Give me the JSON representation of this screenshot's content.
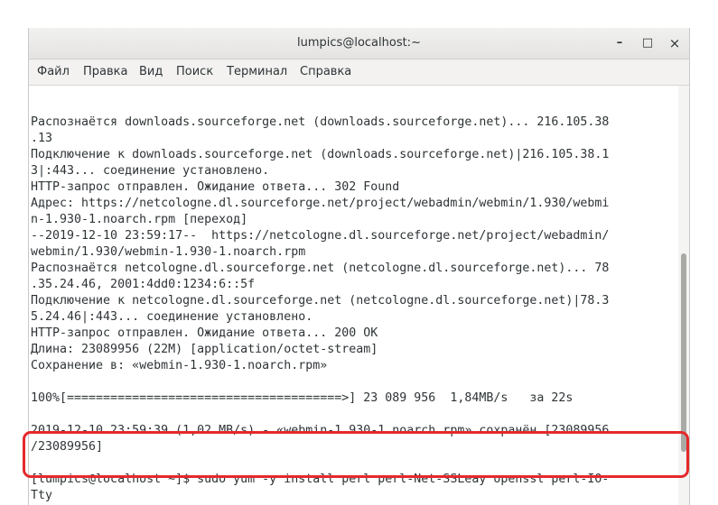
{
  "window": {
    "title": "lumpics@localhost:~",
    "controls": {
      "minimize": "–",
      "maximize": "□",
      "close": "×"
    }
  },
  "menu": [
    "Файл",
    "Правка",
    "Вид",
    "Поиск",
    "Терминал",
    "Справка"
  ],
  "terminal_lines": [
    "Распознаётся downloads.sourceforge.net (downloads.sourceforge.net)... 216.105.38",
    ".13",
    "Подключение к downloads.sourceforge.net (downloads.sourceforge.net)|216.105.38.1",
    "3|:443... соединение установлено.",
    "HTTP-запрос отправлен. Ожидание ответа... 302 Found",
    "Адрес: https://netcologne.dl.sourceforge.net/project/webadmin/webmin/1.930/webmi",
    "n-1.930-1.noarch.rpm [переход]",
    "--2019-12-10 23:59:17--  https://netcologne.dl.sourceforge.net/project/webadmin/",
    "webmin/1.930/webmin-1.930-1.noarch.rpm",
    "Распознаётся netcologne.dl.sourceforge.net (netcologne.dl.sourceforge.net)... 78",
    ".35.24.46, 2001:4dd0:1234:6::5f",
    "Подключение к netcologne.dl.sourceforge.net (netcologne.dl.sourceforge.net)|78.3",
    "5.24.46|:443... соединение установлено.",
    "HTTP-запрос отправлен. Ожидание ответа... 200 OK",
    "Длина: 23089956 (22M) [application/octet-stream]",
    "Сохранение в: «webmin-1.930-1.noarch.rpm»",
    "",
    "100%[======================================>] 23 089 956  1,84MB/s   за 22s",
    "",
    "2019-12-10 23:59:39 (1,02 MB/s) - «webmin-1.930-1.noarch.rpm» сохранён [23089956",
    "/23089956]",
    "",
    "[lumpics@localhost ~]$ sudo yum -y install perl perl-Net-SSLeay openssl perl-IO-",
    "Tty"
  ],
  "colors": {
    "highlight": "#e5282b",
    "text": "#2e3436",
    "titlebar": "#e8e7e5"
  }
}
